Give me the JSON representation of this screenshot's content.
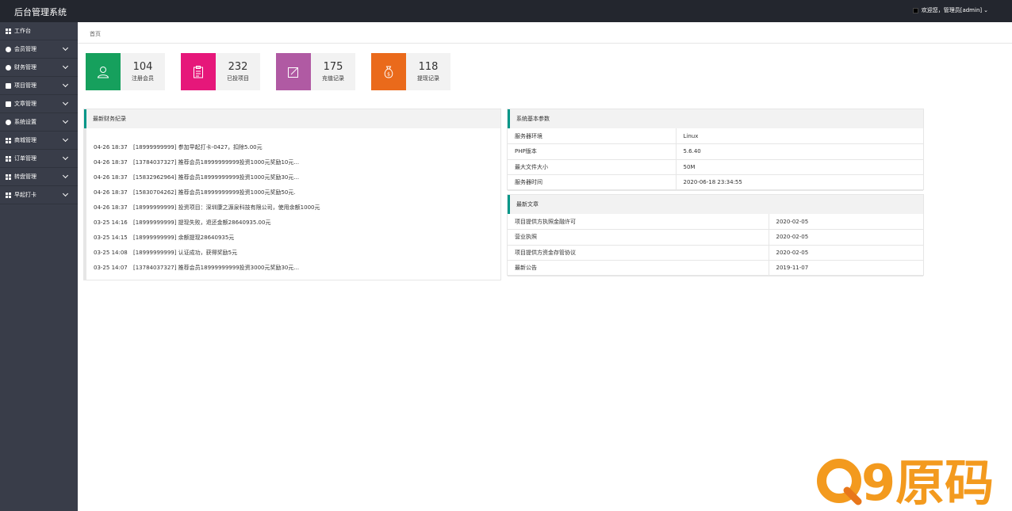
{
  "app_title": "后台管理系统",
  "user_text": "欢迎您，管理员[admin]",
  "sidebar": {
    "items": [
      {
        "label": "工作台",
        "icon": "grid-icon"
      },
      {
        "label": "会员管理",
        "icon": "circle-icon"
      },
      {
        "label": "财务管理",
        "icon": "circle-icon"
      },
      {
        "label": "项目管理",
        "icon": "doc-icon"
      },
      {
        "label": "文章管理",
        "icon": "doc-icon"
      },
      {
        "label": "系统设置",
        "icon": "gear-icon"
      },
      {
        "label": "商城管理",
        "icon": "grid-icon"
      },
      {
        "label": "订单管理",
        "icon": "grid-icon"
      },
      {
        "label": "转盘管理",
        "icon": "grid-icon"
      },
      {
        "label": "早起打卡",
        "icon": "grid-icon"
      }
    ]
  },
  "breadcrumb": "首页",
  "stats": [
    {
      "value": "104",
      "label": "注册会员",
      "color": "#16a05d",
      "icon": "user-icon"
    },
    {
      "value": "232",
      "label": "已投项目",
      "color": "#e6177a",
      "icon": "clipboard-icon"
    },
    {
      "value": "175",
      "label": "充值记录",
      "color": "#b05aa3",
      "icon": "edit-icon"
    },
    {
      "value": "118",
      "label": "提现记录",
      "color": "#ea6a1b",
      "icon": "money-bag-icon"
    }
  ],
  "finance": {
    "title": "最新财务纪录",
    "records": [
      {
        "time": "04-26 18:37",
        "text": "[18999999999] 参加早起打卡-0427，扣除5.00元"
      },
      {
        "time": "04-26 18:37",
        "text": "[13784037327] 推荐会员18999999999投资1000元奖励10元..."
      },
      {
        "time": "04-26 18:37",
        "text": "[15832962964] 推荐会员18999999999投资1000元奖励30元..."
      },
      {
        "time": "04-26 18:37",
        "text": "[15830704262] 推荐会员18999999999投资1000元奖励50元."
      },
      {
        "time": "04-26 18:37",
        "text": "[18999999999] 投资项目：深圳康之源泉科技有限公司，使用余额1000元"
      },
      {
        "time": "03-25 14:16",
        "text": "[18999999999] 提现失败，退还金额28640935.00元"
      },
      {
        "time": "03-25 14:15",
        "text": "[18999999999] 余额提现28640935元"
      },
      {
        "time": "03-25 14:08",
        "text": "[18999999999] 认证成功，获得奖励5元"
      },
      {
        "time": "03-25 14:07",
        "text": "[13784037327] 推荐会员18999999999投资3000元奖励30元..."
      }
    ]
  },
  "system": {
    "title": "系统基本参数",
    "rows": [
      {
        "key": "服务器环境",
        "value": "Linux"
      },
      {
        "key": "PHP版本",
        "value": "5.6.40"
      },
      {
        "key": "最大文件大小",
        "value": "50M"
      },
      {
        "key": "服务器时间",
        "value": "2020-06-18 23:34:55"
      }
    ]
  },
  "articles": {
    "title": "最新文章",
    "rows": [
      {
        "key": "项目提供方执照金融许可",
        "value": "2020-02-05"
      },
      {
        "key": "营业执照",
        "value": "2020-02-05"
      },
      {
        "key": "项目提供方资金存管协议",
        "value": "2020-02-05"
      },
      {
        "key": "最新公告",
        "value": "2019-11-07"
      }
    ]
  },
  "watermark": {
    "text": "Q9原码",
    "color": "#f39a1e"
  }
}
